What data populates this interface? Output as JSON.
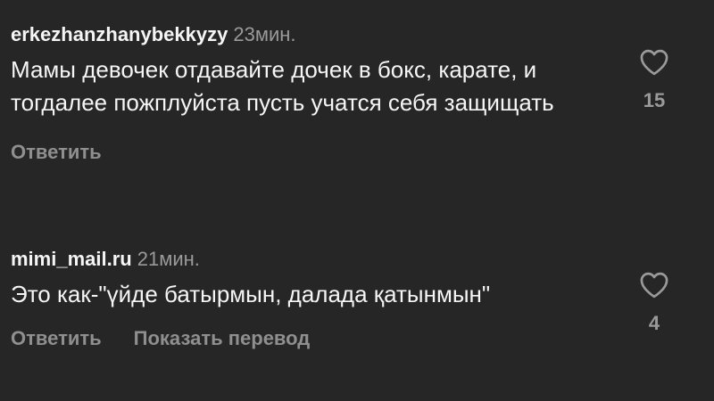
{
  "comments": [
    {
      "username": "erkezhanzhanybekkyzy",
      "time": "23мин.",
      "text": "Мамы девочек отдавайте дочек в бокс, карате, и тогдалее пожплуйста пусть учатся себя защищать",
      "reply_label": "Ответить",
      "like_icon": "heart-outline-icon",
      "likes": "15"
    },
    {
      "username": "mimi_mail.ru",
      "time": "21мин.",
      "text": "Это как-\"үйде батырмын, далада қатынмын\"",
      "reply_label": "Ответить",
      "translate_label": "Показать перевод",
      "like_icon": "heart-outline-icon",
      "likes": "4"
    }
  ],
  "colors": {
    "background": "#262626",
    "text": "#f5f5f5",
    "muted": "#9a9a9a"
  }
}
